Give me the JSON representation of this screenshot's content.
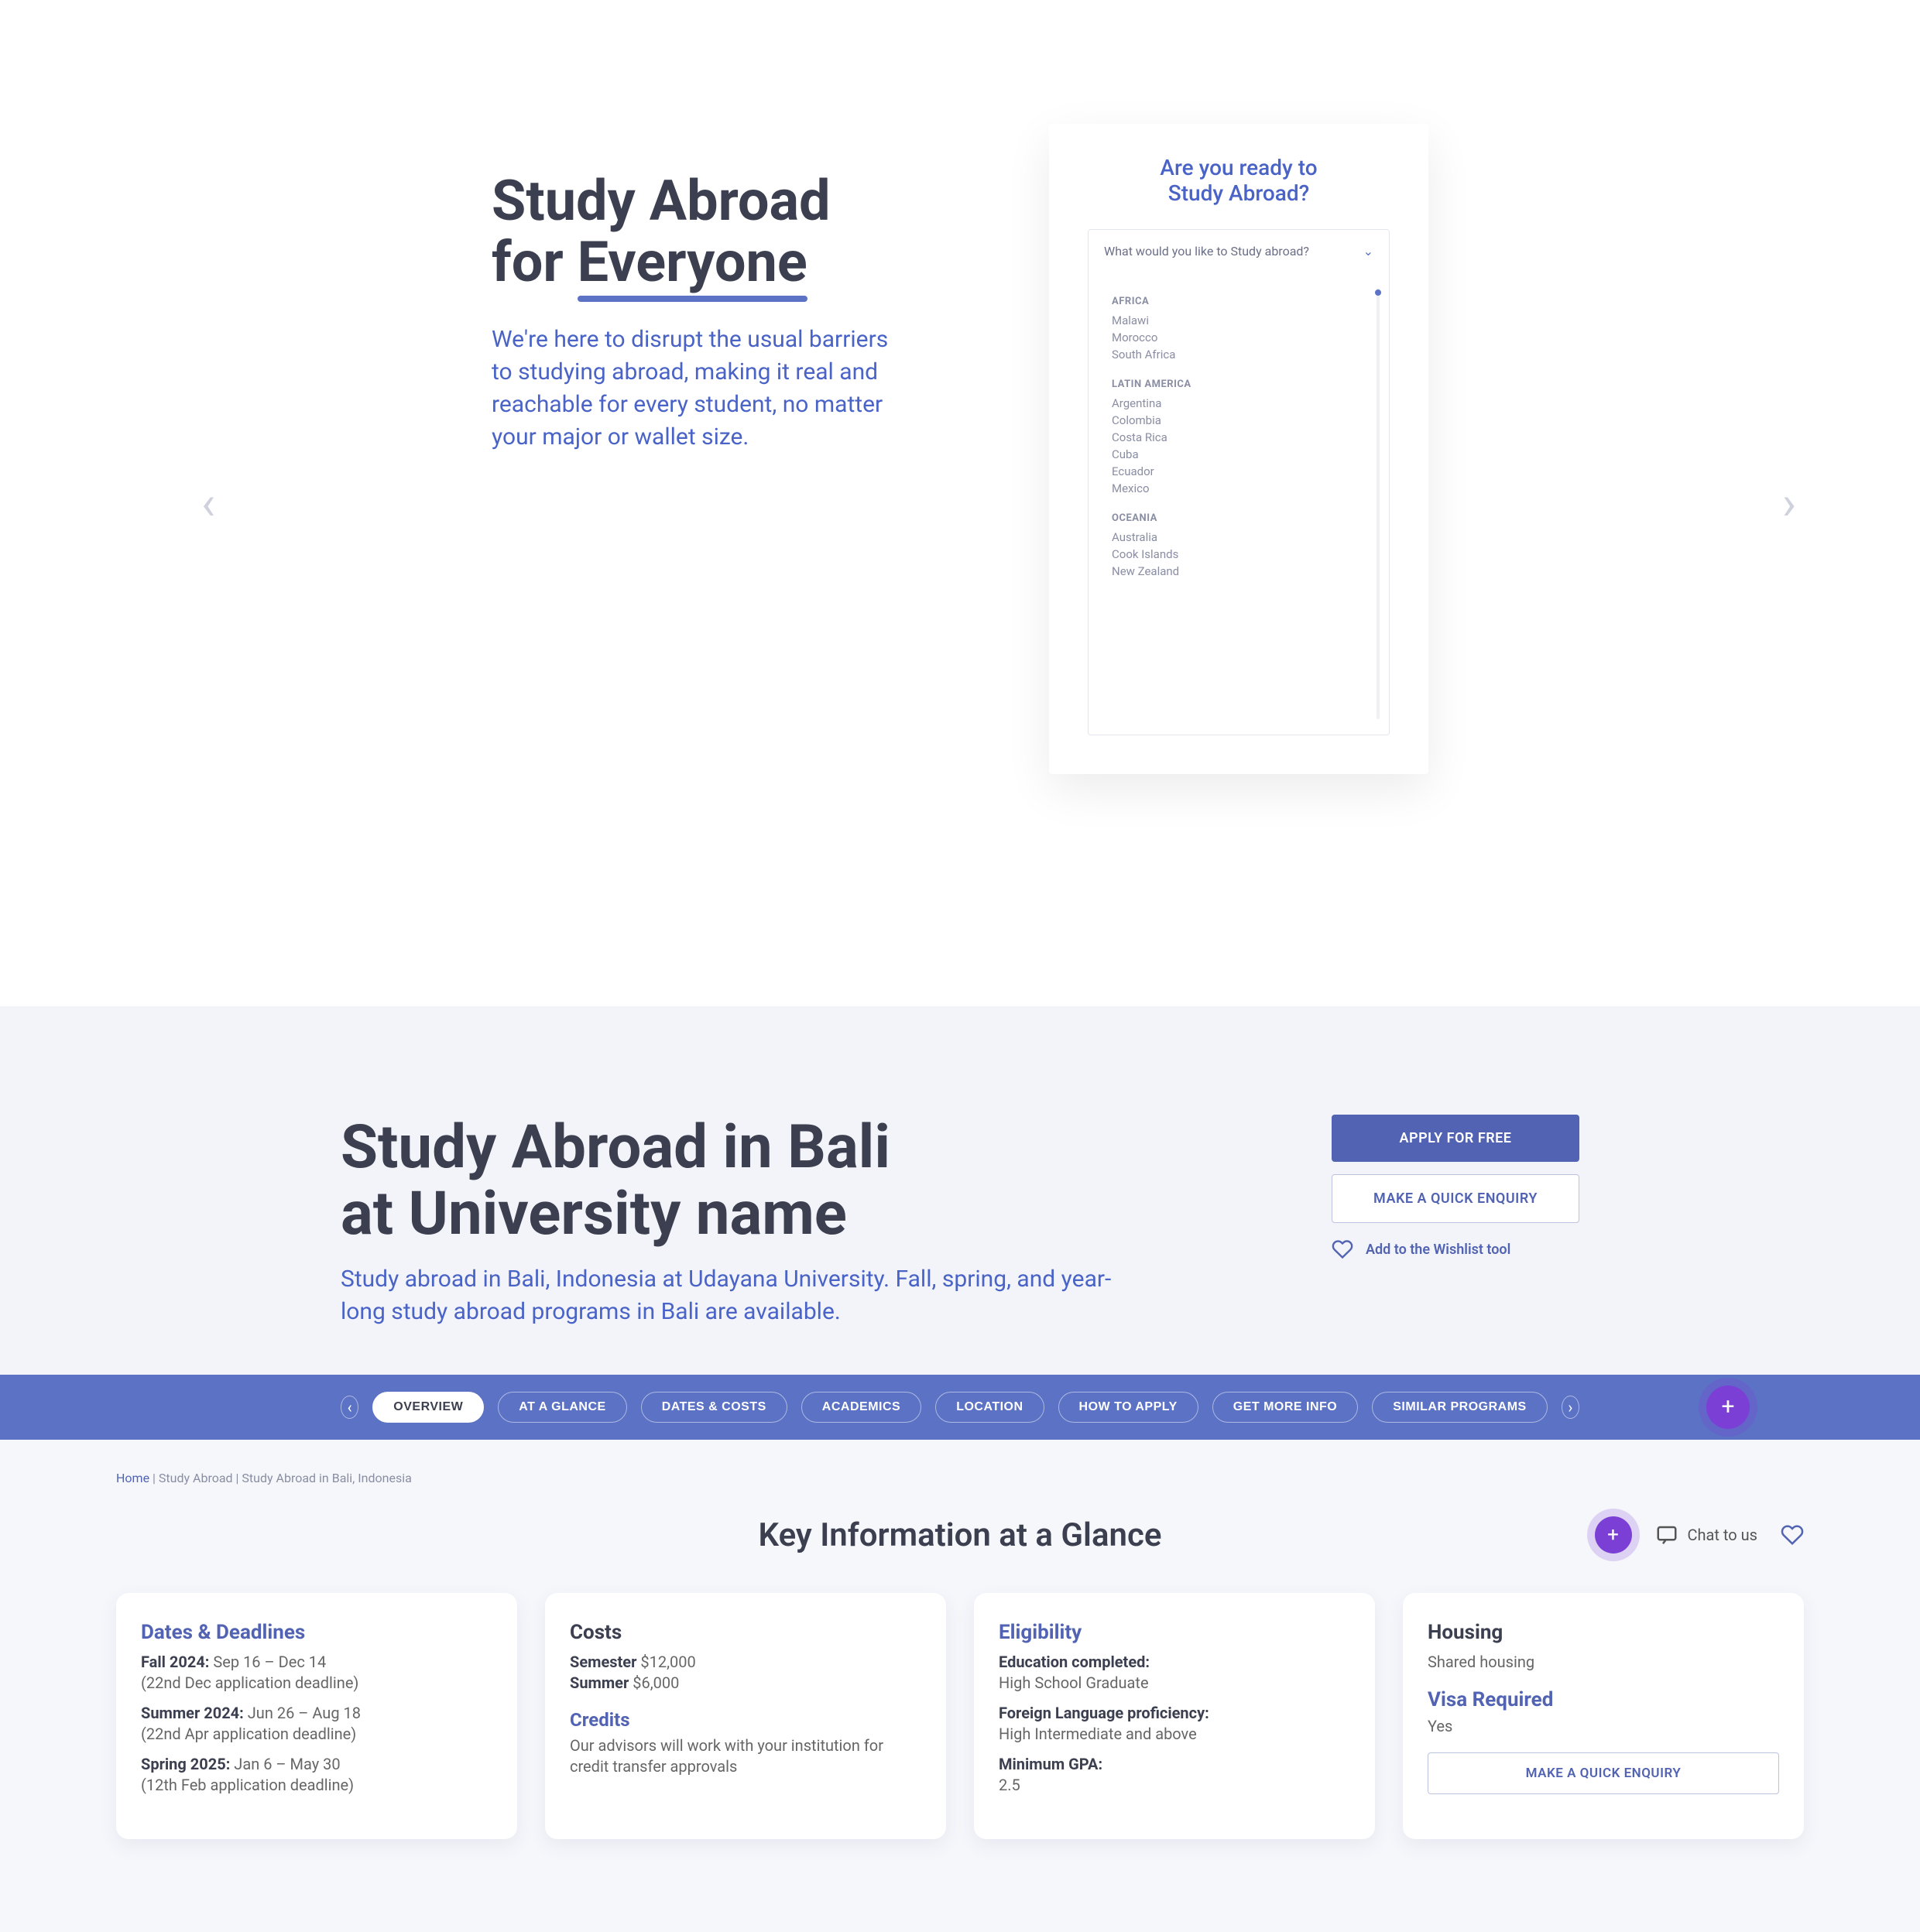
{
  "hero": {
    "title_line1": "Study Abroad",
    "title_line2_prefix": "for ",
    "title_line2_underlined": "Everyone",
    "subtitle": "We're here to disrupt the usual barriers to studying abroad, making it real and reachable for every student, no matter your major or wallet size.",
    "card_title_line1": "Are you ready to",
    "card_title_line2": "Study Abroad?",
    "dropdown_prompt": "What would you like to Study abroad?",
    "regions": [
      {
        "title": "AFRICA",
        "items": [
          "Malawi",
          "Morocco",
          "South Africa"
        ]
      },
      {
        "title": "LATIN AMERICA",
        "items": [
          "Argentina",
          "Colombia",
          "Costa Rica",
          "Cuba",
          "Ecuador",
          "Mexico"
        ]
      },
      {
        "title": "OCEANIA",
        "items": [
          "Australia",
          "Cook Islands",
          "New Zealand"
        ]
      }
    ]
  },
  "program": {
    "title_line1": "Study Abroad in Bali",
    "title_line2": "at University name",
    "subtitle": "Study abroad in Bali, Indonesia at Udayana University. Fall, spring, and year-long study abroad programs in Bali are available.",
    "apply_label": "APPLY FOR FREE",
    "enquiry_label": "MAKE A QUICK ENQUIRY",
    "wishlist_label": "Add to the Wishlist tool"
  },
  "tabs": [
    "OVERVIEW",
    "AT A GLANCE",
    "DATES & COSTS",
    "ACADEMICS",
    "LOCATION",
    "HOW TO APPLY",
    "GET MORE INFO",
    "SIMILAR PROGRAMS"
  ],
  "breadcrumb": {
    "home": "Home",
    "sep1": " | ",
    "l2": "Study Abroad",
    "sep2": " | ",
    "l3": "Study Abroad in Bali, Indonesia"
  },
  "glance": {
    "heading": "Key Information at a Glance",
    "chat_label": "Chat to us"
  },
  "cards": {
    "dates": {
      "title": "Dates & Deadlines",
      "rows": [
        {
          "label": "Fall 2024:",
          "value": " Sep 16 – Dec 14",
          "sub": "(22nd Dec application deadline)"
        },
        {
          "label": "Summer 2024:",
          "value": " Jun 26 – Aug 18",
          "sub": "(22nd Apr application deadline)"
        },
        {
          "label": "Spring 2025:",
          "value": " Jan 6 – May 30",
          "sub": "(12th Feb application deadline)"
        }
      ]
    },
    "costs": {
      "title": "Costs",
      "rows": [
        {
          "label": "Semester",
          "value": " $12,000"
        },
        {
          "label": "Summer",
          "value": " $6,000"
        }
      ],
      "credits_title": "Credits",
      "credits_text": "Our advisors will work with your institution for credit transfer approvals"
    },
    "elig": {
      "title": "Eligibility",
      "rows": [
        {
          "label": "Education completed:",
          "value": "High School Graduate"
        },
        {
          "label": "Foreign Language proficiency:",
          "value": "High Intermediate and above"
        },
        {
          "label": "Minimum GPA:",
          "value": "2.5"
        }
      ]
    },
    "housing": {
      "housing_title": "Housing",
      "housing_value": "Shared housing",
      "visa_title": "Visa Required",
      "visa_value": "Yes",
      "enquiry_label": "MAKE A QUICK ENQUIRY"
    }
  }
}
